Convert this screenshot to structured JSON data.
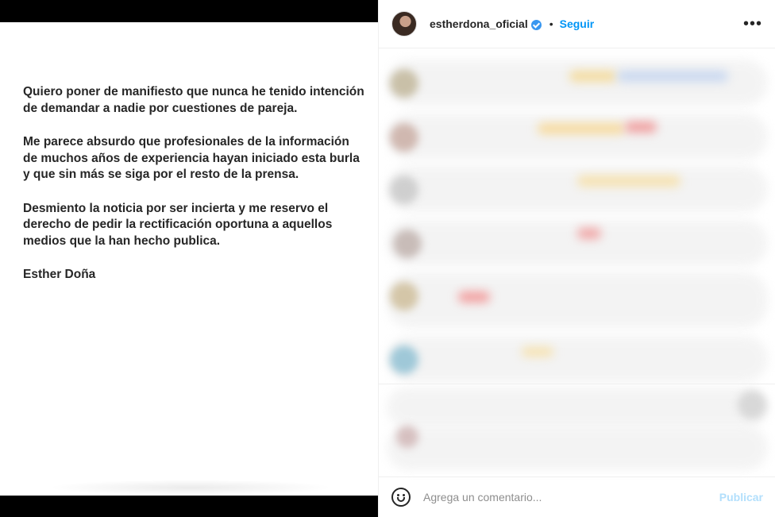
{
  "post": {
    "paragraphs": [
      "Quiero poner de manifiesto que nunca he tenido intención de demandar a nadie por cuestiones de pareja.",
      "Me parece absurdo que profesionales de la información de muchos años de experiencia hayan iniciado esta burla y que sin más se siga por el resto de la prensa.",
      "Desmiento la noticia por ser incierta y me reservo el derecho de pedir la rectificación oportuna a aquellos medios que la han hecho publica."
    ],
    "signature": "Esther Doña"
  },
  "header": {
    "username": "estherdona_oficial",
    "separator": "•",
    "follow_label": "Seguir",
    "more_label": "•••"
  },
  "composer": {
    "placeholder": "Agrega un comentario...",
    "publish_label": "Publicar"
  },
  "colors": {
    "accent": "#0095f6",
    "verified": "#3897f0",
    "publish_disabled": "#b2dffc"
  }
}
